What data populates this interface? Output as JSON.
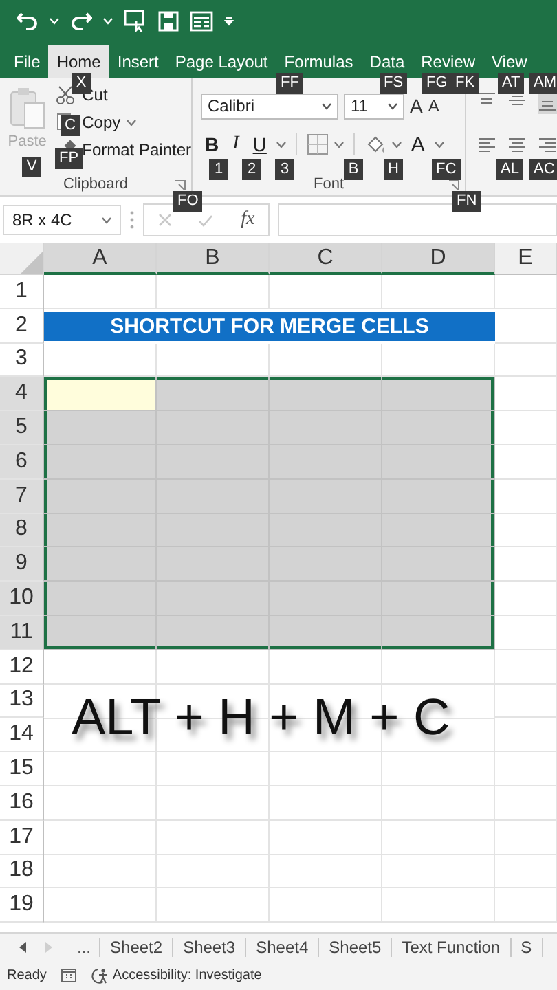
{
  "tabs": [
    {
      "label": "File",
      "selected": false
    },
    {
      "label": "Home",
      "selected": true
    },
    {
      "label": "Insert",
      "selected": false
    },
    {
      "label": "Page Layout",
      "selected": false
    },
    {
      "label": "Formulas",
      "selected": false
    },
    {
      "label": "Data",
      "selected": false
    },
    {
      "label": "Review",
      "selected": false
    },
    {
      "label": "View",
      "selected": false
    }
  ],
  "ribbon": {
    "clipboard": {
      "paste": {
        "label": "Paste",
        "disabled": true
      },
      "cut": "Cut",
      "copy": "Copy",
      "format_painter": "Format Painter",
      "label": "Clipboard"
    },
    "font": {
      "name": "Calibri",
      "size": "11",
      "grow": "A",
      "shrink": "A",
      "bold": "B",
      "italic": "I",
      "underline": "U",
      "font_color": "A",
      "label": "Font"
    }
  },
  "key_tips": [
    "X",
    "C",
    "FP",
    "V",
    "FF",
    "FS",
    "FG",
    "FK",
    "AT",
    "AM",
    "1",
    "2",
    "3",
    "B",
    "H",
    "FC",
    "FO",
    "FN",
    "AL",
    "AC"
  ],
  "formula_bar": {
    "name_box": "8R x 4C",
    "fx": "fx"
  },
  "sheet": {
    "columns": [
      {
        "label": "A",
        "selected": true,
        "active": true
      },
      {
        "label": "B",
        "selected": true
      },
      {
        "label": "C",
        "selected": true
      },
      {
        "label": "D",
        "selected": true
      },
      {
        "label": "E",
        "selected": false
      }
    ],
    "rows": [
      {
        "label": "1",
        "selected": false
      },
      {
        "label": "2",
        "selected": false,
        "title": "SHORTCUT FOR MERGE CELLS"
      },
      {
        "label": "3",
        "selected": false
      },
      {
        "label": "4",
        "selected": true,
        "active": true
      },
      {
        "label": "5",
        "selected": true
      },
      {
        "label": "6",
        "selected": true
      },
      {
        "label": "7",
        "selected": true
      },
      {
        "label": "8",
        "selected": true
      },
      {
        "label": "9",
        "selected": true
      },
      {
        "label": "10",
        "selected": true
      },
      {
        "label": "11",
        "selected": true
      },
      {
        "label": "12",
        "selected": false
      },
      {
        "label": "13",
        "selected": false,
        "caption": "ALT + H + M + C"
      },
      {
        "label": "14",
        "selected": false
      },
      {
        "label": "15",
        "selected": false
      },
      {
        "label": "16",
        "selected": false
      },
      {
        "label": "17",
        "selected": false
      },
      {
        "label": "18",
        "selected": false
      },
      {
        "label": "19",
        "selected": false
      }
    ]
  },
  "sheet_tabs": {
    "more": "...",
    "tabs": [
      {
        "label": "Sheet2",
        "selected": false
      },
      {
        "label": "Sheet3",
        "selected": false
      },
      {
        "label": "Sheet4",
        "selected": false
      },
      {
        "label": "Sheet5",
        "selected": false
      },
      {
        "label": "Text Function",
        "selected": false
      },
      {
        "label": "S",
        "selected": false
      }
    ]
  },
  "status_bar": {
    "mode": "Ready",
    "accessibility": "Accessibility: Investigate"
  }
}
